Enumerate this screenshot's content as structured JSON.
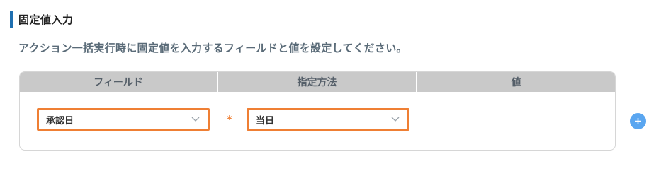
{
  "section": {
    "title": "固定値入力",
    "description": "アクション一括実行時に固定値を入力するフィールドと値を設定してください。"
  },
  "table": {
    "headers": [
      "フィールド",
      "指定方法",
      "値"
    ],
    "row": {
      "field_value": "承認日",
      "required_mark": "*",
      "method_value": "当日"
    }
  },
  "colors": {
    "accent_bar": "#1f6fb0",
    "highlight_border": "#ef7f34",
    "add_button": "#5aa6f0",
    "header_bg": "#c9c9c9"
  },
  "icons": {
    "dropdown": "chevron-down-icon",
    "add": "plus-icon"
  }
}
